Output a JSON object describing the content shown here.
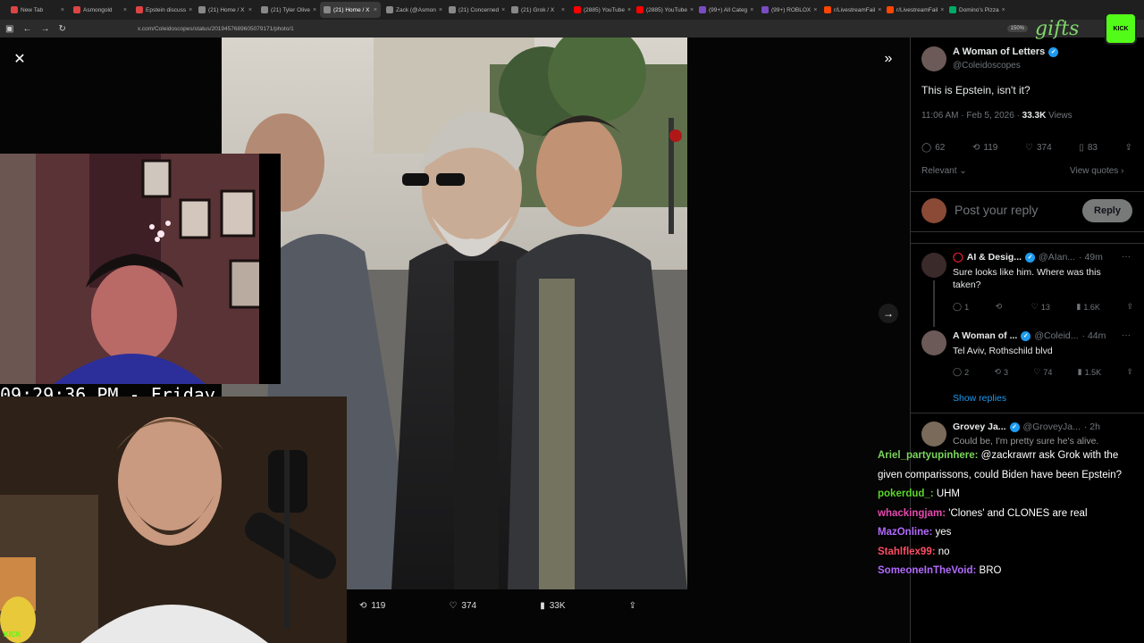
{
  "browser": {
    "tabs": [
      {
        "label": "New Tab",
        "color": "#d44"
      },
      {
        "label": "Asmongold",
        "color": "#d44"
      },
      {
        "label": "Epstein discuss",
        "color": "#d44"
      },
      {
        "label": "(21) Home / X",
        "color": "#888"
      },
      {
        "label": "(21) Tyler Olive",
        "color": "#888"
      },
      {
        "label": "(21) Home / X",
        "color": "#888",
        "active": true
      },
      {
        "label": "Zack (@Asmon",
        "color": "#888"
      },
      {
        "label": "(21) Concerned",
        "color": "#888"
      },
      {
        "label": "(21) Grok / X",
        "color": "#888"
      },
      {
        "label": "(2885) YouTube",
        "color": "#f00"
      },
      {
        "label": "(2885) YouTube",
        "color": "#f00"
      },
      {
        "label": "(99+) All Categ",
        "color": "#7a4cc2"
      },
      {
        "label": "(99+) ROBLOX",
        "color": "#7a4cc2"
      },
      {
        "label": "r/LivestreamFail",
        "color": "#ff4500"
      },
      {
        "label": "r/LivestreamFail",
        "color": "#ff4500"
      },
      {
        "label": "Domino's Pizza",
        "color": "#0a6"
      }
    ],
    "url": "x.com/Coleidoscopes/status/2019457689605079171/photo/1",
    "zoom": "150%"
  },
  "post": {
    "author_name": "A Woman of Letters",
    "author_handle": "@Coleidoscopes",
    "text": "This is Epstein, isn't it?",
    "time": "11:06 AM · Feb 5, 2026 · ",
    "views": "33.3K",
    "views_label": " Views",
    "replies": "62",
    "reposts": "119",
    "likes": "374",
    "bookmarks": "83",
    "sort_label": "Relevant",
    "view_quotes": "View quotes",
    "reply_placeholder": "Post your reply",
    "reply_button": "Reply"
  },
  "photo_actions": {
    "reposts": "119",
    "likes": "374",
    "views": "33K"
  },
  "comments": [
    {
      "name": "AI & Desig...",
      "handle": "@AIan...",
      "time": "· 49m",
      "text": "Sure looks like him. Where was this taken?",
      "replies": "1",
      "reposts": "",
      "likes": "13",
      "views": "1.6K"
    },
    {
      "name": "A Woman of ...",
      "handle": "@Coleid...",
      "time": "· 44m",
      "text": "Tel Aviv, Rothschild blvd",
      "replies": "2",
      "reposts": "3",
      "likes": "74",
      "views": "1.5K"
    },
    {
      "name": "Grovey Ja...",
      "handle": "@GroveyJa...",
      "time": "· 2h",
      "text": "Could be, I'm pretty sure he's alive."
    }
  ],
  "show_replies": "Show replies",
  "clock": "09:29:36 PM - Friday",
  "chat": [
    {
      "user": "Ariel_partyupinhere:",
      "color": "#7bd65c",
      "msg": " @zackrawrr ask Grok with the given comparissons, could Biden have been Epstein?"
    },
    {
      "user": "pokerdud_:",
      "color": "#5dd62c",
      "msg": " UHM"
    },
    {
      "user": "whackingjam:",
      "color": "#e64bb1",
      "msg": " 'Clones' and CLONES are real"
    },
    {
      "user": "MazOnline:",
      "color": "#b26bff",
      "msg": " yes"
    },
    {
      "user": "Stahlflex99:",
      "color": "#ff4f66",
      "msg": " no"
    },
    {
      "user": "SomeoneInTheVoid:",
      "color": "#b26bff",
      "msg": " BRO"
    }
  ],
  "overlay": {
    "gifts": "gifts",
    "kick_badge": "KICK",
    "kick_logo": "KICK"
  }
}
